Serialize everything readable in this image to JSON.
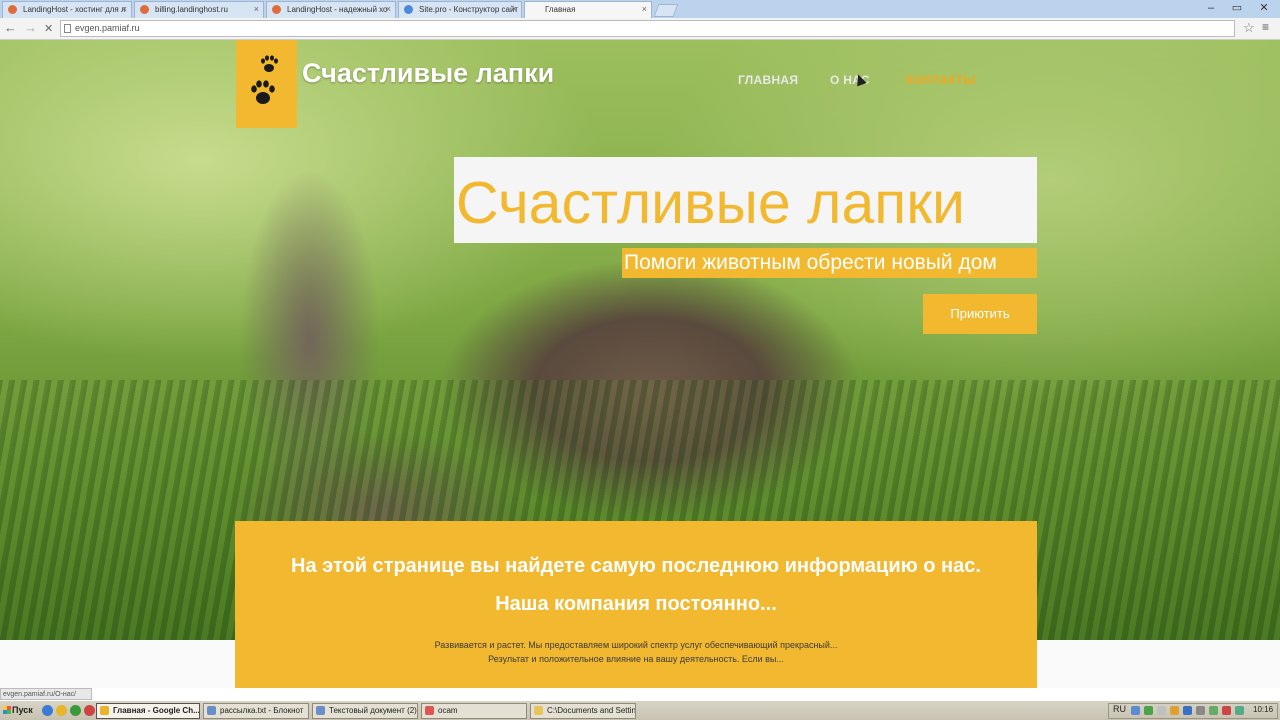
{
  "browser": {
    "tabs": [
      {
        "title": "LandingHost - хостинг для л"
      },
      {
        "title": "billing.landinghost.ru"
      },
      {
        "title": "LandingHost - надежный хо"
      },
      {
        "title": "Site.pro - Конструктор сайт"
      },
      {
        "title": "Главная",
        "active": true
      }
    ],
    "address": "evgen.pamiaf.ru",
    "status_url": "evgen.pamiaf.ru/О-нас/",
    "close_glyph": "×",
    "back_glyph": "←",
    "forward_glyph": "→",
    "reload_glyph": "✕",
    "star_glyph": "☆",
    "menu_glyph": "≡",
    "min_glyph": "–",
    "max_glyph": "▭",
    "winclose_glyph": "✕"
  },
  "site": {
    "brand": "Счастливые лапки",
    "nav": [
      {
        "label": "ГЛАВНАЯ"
      },
      {
        "label": "О НАС"
      },
      {
        "label": "КОНТАКТЫ",
        "active": true
      }
    ],
    "hero_title": "Счастливые лапки",
    "hero_subtitle": "Помоги животным обрести новый дом",
    "cta_label": "Приютить",
    "info_heading_line1": "На этой странице вы найдете самую последнюю информацию о нас.",
    "info_heading_line2": "Наша компания постоянно...",
    "info_text_line1": "Развивается и растет. Мы предоставляем широкий спектр услуг обеспечивающий прекрасный...",
    "info_text_line2": "Результат и положительное влияние на вашу деятельность. Если вы...",
    "accent_color": "#f2b930",
    "active_nav_color": "#f2a81d"
  },
  "taskbar": {
    "start": "Пуск",
    "tasks": [
      {
        "label": "Главная - Google Ch...",
        "active": true
      },
      {
        "label": "рассылка.txt - Блокнот"
      },
      {
        "label": "Текстовый документ (2)..."
      },
      {
        "label": "ocam"
      },
      {
        "label": "C:\\Documents and Settin..."
      }
    ],
    "lang": "RU",
    "clock": "10:16"
  }
}
